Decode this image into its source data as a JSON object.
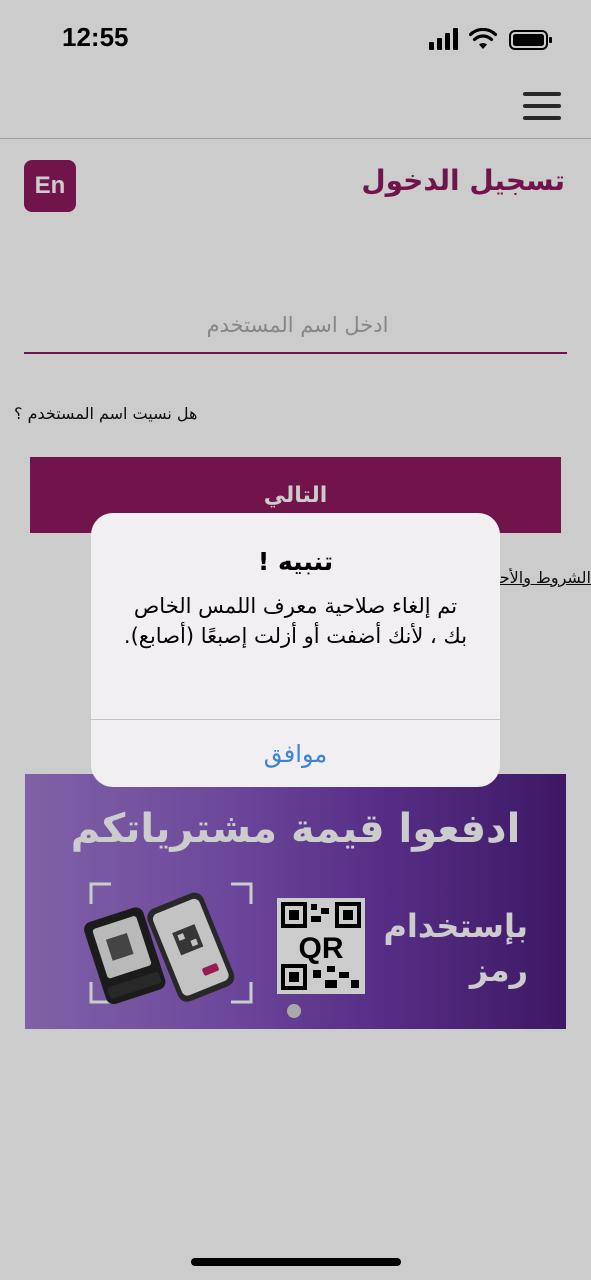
{
  "status_bar": {
    "time": "12:55",
    "icons": [
      "signal-icon",
      "wifi-icon",
      "battery-icon"
    ]
  },
  "header": {
    "menu_icon": "menu-icon"
  },
  "login": {
    "title": "تسجيل الدخول",
    "language_button": "En",
    "username_placeholder": "ادخل اسم المستخدم",
    "forgot_username": "هل نسيت اسم المستخدم ؟",
    "next_button": "التالي",
    "terms_link": "الشروط والأحكام"
  },
  "banner": {
    "headline": "ادفعوا قيمة مشترياتكم",
    "subline": "بإستخدام رمز",
    "qr_text": "QR",
    "icons": [
      "qr-code-icon",
      "payment-terminal-icon",
      "smartphone-icon"
    ]
  },
  "alert": {
    "title": "تنبيه !",
    "message": "تم إلغاء صلاحية معرف اللمس الخاص بك ، لأنك أضفت أو أزلت إصبعًا (أصابع).",
    "ok_button": "موافق"
  },
  "colors": {
    "brand": "#8c1a5e",
    "alert_button": "#3b82d8",
    "banner_start": "#a07ad0",
    "banner_end": "#4d1f7e"
  }
}
